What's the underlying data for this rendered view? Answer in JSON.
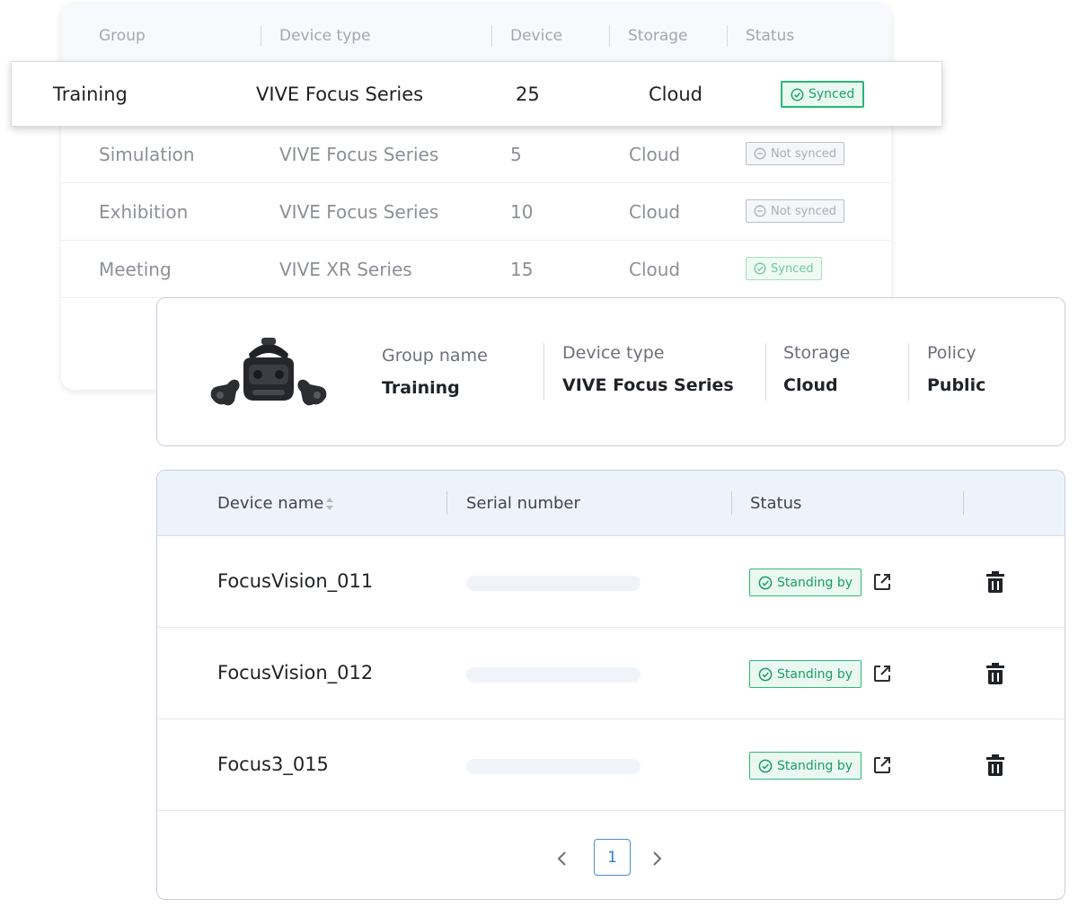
{
  "groups_table": {
    "columns": [
      "Group",
      "Device type",
      "Device",
      "Storage",
      "Status"
    ],
    "rows": [
      {
        "group": "Simulation",
        "device_type": "VIVE Focus Series",
        "device": "5",
        "storage": "Cloud",
        "status": "Not synced"
      },
      {
        "group": "Exhibition",
        "device_type": "VIVE Focus Series",
        "device": "10",
        "storage": "Cloud",
        "status": "Not synced"
      },
      {
        "group": "Meeting",
        "device_type": "VIVE XR Series",
        "device": "15",
        "storage": "Cloud",
        "status": "Synced"
      }
    ]
  },
  "highlighted_row": {
    "group": "Training",
    "device_type": "VIVE Focus Series",
    "device": "25",
    "storage": "Cloud",
    "status": "Synced"
  },
  "group_info": {
    "image": "vr-headset-with-controllers",
    "fields": [
      {
        "label": "Group name",
        "value": "Training"
      },
      {
        "label": "Device type",
        "value": "VIVE Focus Series"
      },
      {
        "label": "Storage",
        "value": "Cloud"
      },
      {
        "label": "Policy",
        "value": "Public"
      }
    ]
  },
  "devices_table": {
    "columns": {
      "device_name": "Device name",
      "serial_number": "Serial number",
      "status": "Status"
    },
    "rows": [
      {
        "name": "FocusVision_011",
        "status": "Standing by"
      },
      {
        "name": "FocusVision_012",
        "status": "Standing by"
      },
      {
        "name": "Focus3_015",
        "status": "Standing by"
      }
    ],
    "icons": {
      "sort": "sort-icon",
      "open": "external-link-icon",
      "delete": "trash-icon",
      "status": "check-circle-icon"
    }
  },
  "pagination": {
    "current_page": "1"
  },
  "colors": {
    "synced_green": "#1aa56a",
    "not_synced_gray": "#a9aeb6",
    "header_bg": "#edf3fb",
    "page_accent": "#2f7cc7"
  }
}
